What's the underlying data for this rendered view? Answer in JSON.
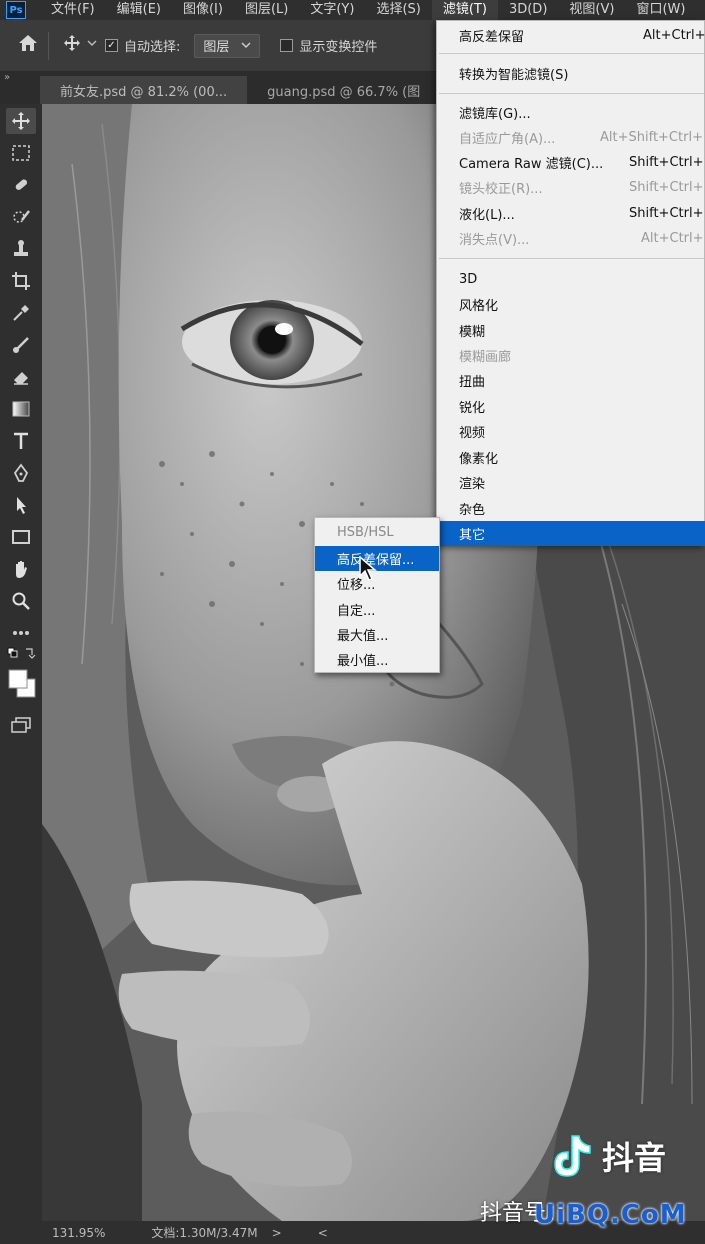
{
  "menubar": {
    "logo": "Ps",
    "items": [
      "文件(F)",
      "编辑(E)",
      "图像(I)",
      "图层(L)",
      "文字(Y)",
      "选择(S)",
      "滤镜(T)",
      "3D(D)",
      "视图(V)",
      "窗口(W)"
    ]
  },
  "options": {
    "auto_select_label": "自动选择:",
    "auto_select_checked": "✓",
    "layer_dropdown": "图层",
    "transform_label": "显示变换控件"
  },
  "tabs": [
    "前女友.psd @ 81.2% (00...",
    "guang.psd @ 66.7% (图"
  ],
  "filter_menu": {
    "items": [
      {
        "label": "高反差保留",
        "shortcut": "Alt+Ctrl+"
      },
      {
        "label": "转换为智能滤镜(S)",
        "shortcut": ""
      },
      {
        "label": "滤镜库(G)...",
        "shortcut": ""
      },
      {
        "label": "自适应广角(A)...",
        "shortcut": "Alt+Shift+Ctrl+"
      },
      {
        "label": "Camera Raw 滤镜(C)...",
        "shortcut": "Shift+Ctrl+"
      },
      {
        "label": "镜头校正(R)...",
        "shortcut": "Shift+Ctrl+"
      },
      {
        "label": "液化(L)...",
        "shortcut": "Shift+Ctrl+"
      },
      {
        "label": "消失点(V)...",
        "shortcut": "Alt+Ctrl+"
      },
      {
        "label": "3D",
        "shortcut": ""
      },
      {
        "label": "风格化",
        "shortcut": ""
      },
      {
        "label": "模糊",
        "shortcut": ""
      },
      {
        "label": "模糊画廊",
        "shortcut": ""
      },
      {
        "label": "扭曲",
        "shortcut": ""
      },
      {
        "label": "锐化",
        "shortcut": ""
      },
      {
        "label": "视频",
        "shortcut": ""
      },
      {
        "label": "像素化",
        "shortcut": ""
      },
      {
        "label": "渲染",
        "shortcut": ""
      },
      {
        "label": "杂色",
        "shortcut": ""
      },
      {
        "label": "其它",
        "shortcut": ""
      }
    ]
  },
  "submenu": {
    "items": [
      "HSB/HSL",
      "高反差保留...",
      "位移...",
      "自定...",
      "最大值...",
      "最小值..."
    ]
  },
  "status": {
    "zoom": "131.95%",
    "doc": "文档:1.30M/3.47M",
    "arrow_right": ">",
    "arrow_left": "<"
  },
  "watermarks": {
    "douyin": "抖音",
    "douyin_id": "抖音号：",
    "uibq": "UiBQ.CoM"
  },
  "colors": {
    "menu_highlight": "#0a64c8",
    "app_bg": "#2f2f2f",
    "menu_bg": "#f0f0f0"
  }
}
